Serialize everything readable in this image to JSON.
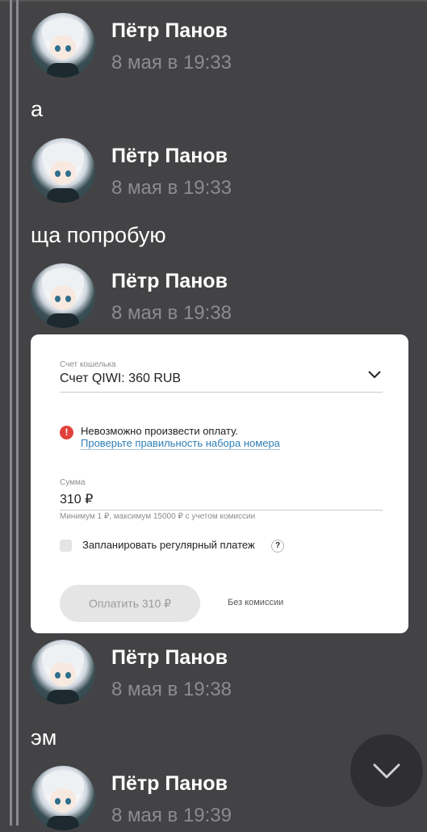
{
  "messages": [
    {
      "author": "Пётр Панов",
      "time": "8 мая в 19:33",
      "text": "а"
    },
    {
      "author": "Пётр Панов",
      "time": "8 мая в 19:33",
      "text": "ща попробую"
    },
    {
      "author": "Пётр Панов",
      "time": "8 мая в 19:38",
      "text": ""
    },
    {
      "author": "Пётр Панов",
      "time": "8 мая в 19:38",
      "text": "эм"
    },
    {
      "author": "Пётр Панов",
      "time": "8 мая в 19:39",
      "text": ""
    }
  ],
  "payment_card": {
    "wallet_label": "Счет кошелька",
    "wallet_value": "Счет QIWI: 360 RUB",
    "error_title": "Невозможно произвести оплату.",
    "error_link": "Проверьте правильность набора номера",
    "amount_label": "Сумма",
    "amount_value": "310 ₽",
    "amount_hint": "Минимум 1 ₽, максимум 15000 ₽ с учетом комиссии",
    "schedule_label": "Запланировать регулярный платеж",
    "help_glyph": "?",
    "error_glyph": "!",
    "pay_button": "Оплатить 310 ₽",
    "fee_note": "Без комиссии"
  },
  "icons": {
    "wallet_dropdown": "chevron-down-icon",
    "scroll_down": "chevron-down-icon"
  },
  "colors": {
    "background": "#434345",
    "error": "#e2403b",
    "link": "#2f7fb5"
  }
}
